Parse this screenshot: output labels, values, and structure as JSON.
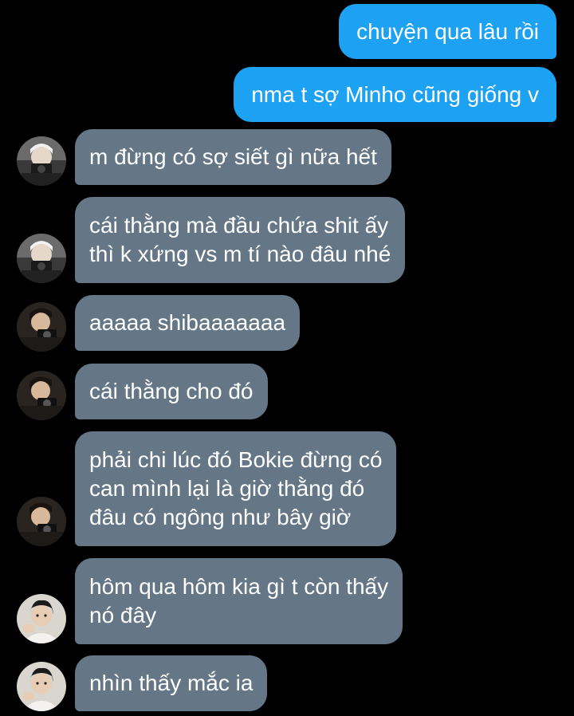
{
  "messages": [
    {
      "from": "me",
      "text": "chuyện qua lâu rồi"
    },
    {
      "from": "me",
      "text": "nma t sợ Minho cũng giống v"
    },
    {
      "from": "friend_a",
      "avatar": "avatar-light-hair-camera",
      "text": "m đừng có sợ siết gì nữa hết"
    },
    {
      "from": "friend_a",
      "avatar": "avatar-light-hair-camera",
      "lines": [
        "cái thằng mà đầu chứa shit ấy",
        "thì k xứng vs m tí nào đâu nhé"
      ]
    },
    {
      "from": "friend_b",
      "avatar": "avatar-dark-hair-camera",
      "text": "aaaaa shibaaaaaaa"
    },
    {
      "from": "friend_b",
      "avatar": "avatar-dark-hair-camera",
      "text": "cái thằng cho đó"
    },
    {
      "from": "friend_b",
      "avatar": "avatar-dark-hair-camera",
      "lines": [
        "phải chi lúc đó Bokie đừng có",
        "can mình lại là giờ thằng đó",
        "đâu có ngông như bây giờ"
      ]
    },
    {
      "from": "friend_c",
      "avatar": "avatar-boy-portrait",
      "lines": [
        "hôm qua hôm kia gì t còn thấy",
        "nó đây"
      ]
    },
    {
      "from": "friend_c",
      "avatar": "avatar-boy-portrait",
      "text": "nhìn thấy mắc ia"
    }
  ],
  "colors": {
    "background": "#000000",
    "sent_bubble": "#1DA1F2",
    "received_bubble": "#657786",
    "text": "#FFFFFF"
  }
}
